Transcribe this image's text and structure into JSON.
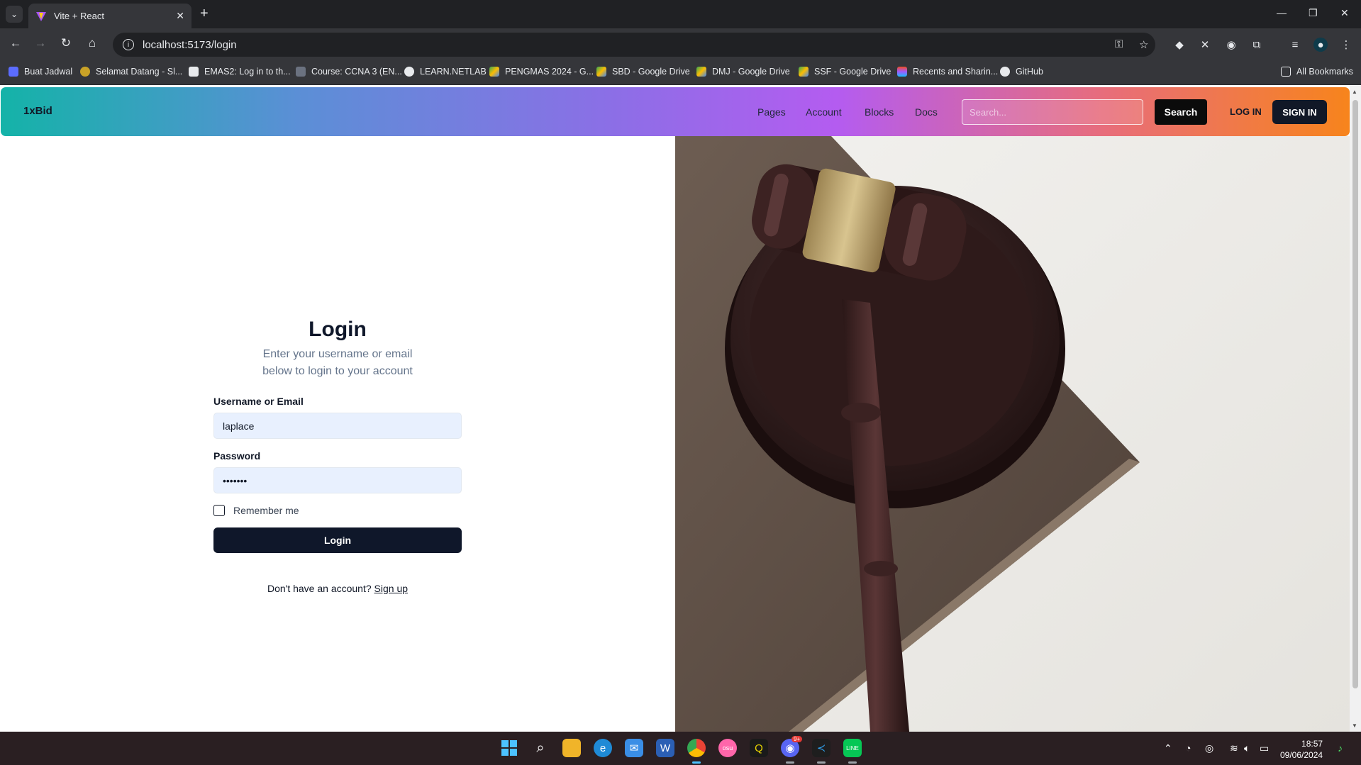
{
  "browser": {
    "tab_title": "Vite + React",
    "url": "localhost:5173/login",
    "bookmarks": [
      {
        "label": "Buat Jadwal",
        "color": "#5b6cff"
      },
      {
        "label": "Selamat Datang - Sl...",
        "color": "#c9a227"
      },
      {
        "label": "EMAS2: Log in to th...",
        "color": "#e8eaed"
      },
      {
        "label": "Course: CCNA 3 (EN...",
        "color": "#6b7280"
      },
      {
        "label": "LEARN.NETLAB",
        "color": "#e8eaed"
      },
      {
        "label": "PENGMAS 2024 - G...",
        "color": "#34a853"
      },
      {
        "label": "SBD - Google Drive",
        "color": "#4285f4"
      },
      {
        "label": "DMJ - Google Drive",
        "color": "#fbbc04"
      },
      {
        "label": "SSF - Google Drive",
        "color": "#34a853"
      },
      {
        "label": "Recents and Sharin...",
        "color": "#f24e1e"
      },
      {
        "label": "GitHub",
        "color": "#e8eaed"
      }
    ],
    "all_bookmarks": "All Bookmarks"
  },
  "header": {
    "brand": "1xBid",
    "nav": [
      "Pages",
      "Account",
      "Blocks",
      "Docs"
    ],
    "search_placeholder": "Search...",
    "search_button": "Search",
    "login_link": "LOG IN",
    "signin_button": "SIGN IN"
  },
  "login": {
    "title": "Login",
    "subtitle_line1": "Enter your username or email",
    "subtitle_line2": "below to login to your account",
    "username_label": "Username or Email",
    "username_value": "laplace",
    "password_label": "Password",
    "password_value": "•••••••",
    "remember_label": "Remember me",
    "login_button": "Login",
    "signup_prompt": "Don't have an account?",
    "signup_link": "Sign up"
  },
  "taskbar": {
    "time": "18:57",
    "date": "09/06/2024",
    "discord_badge": "9+"
  }
}
